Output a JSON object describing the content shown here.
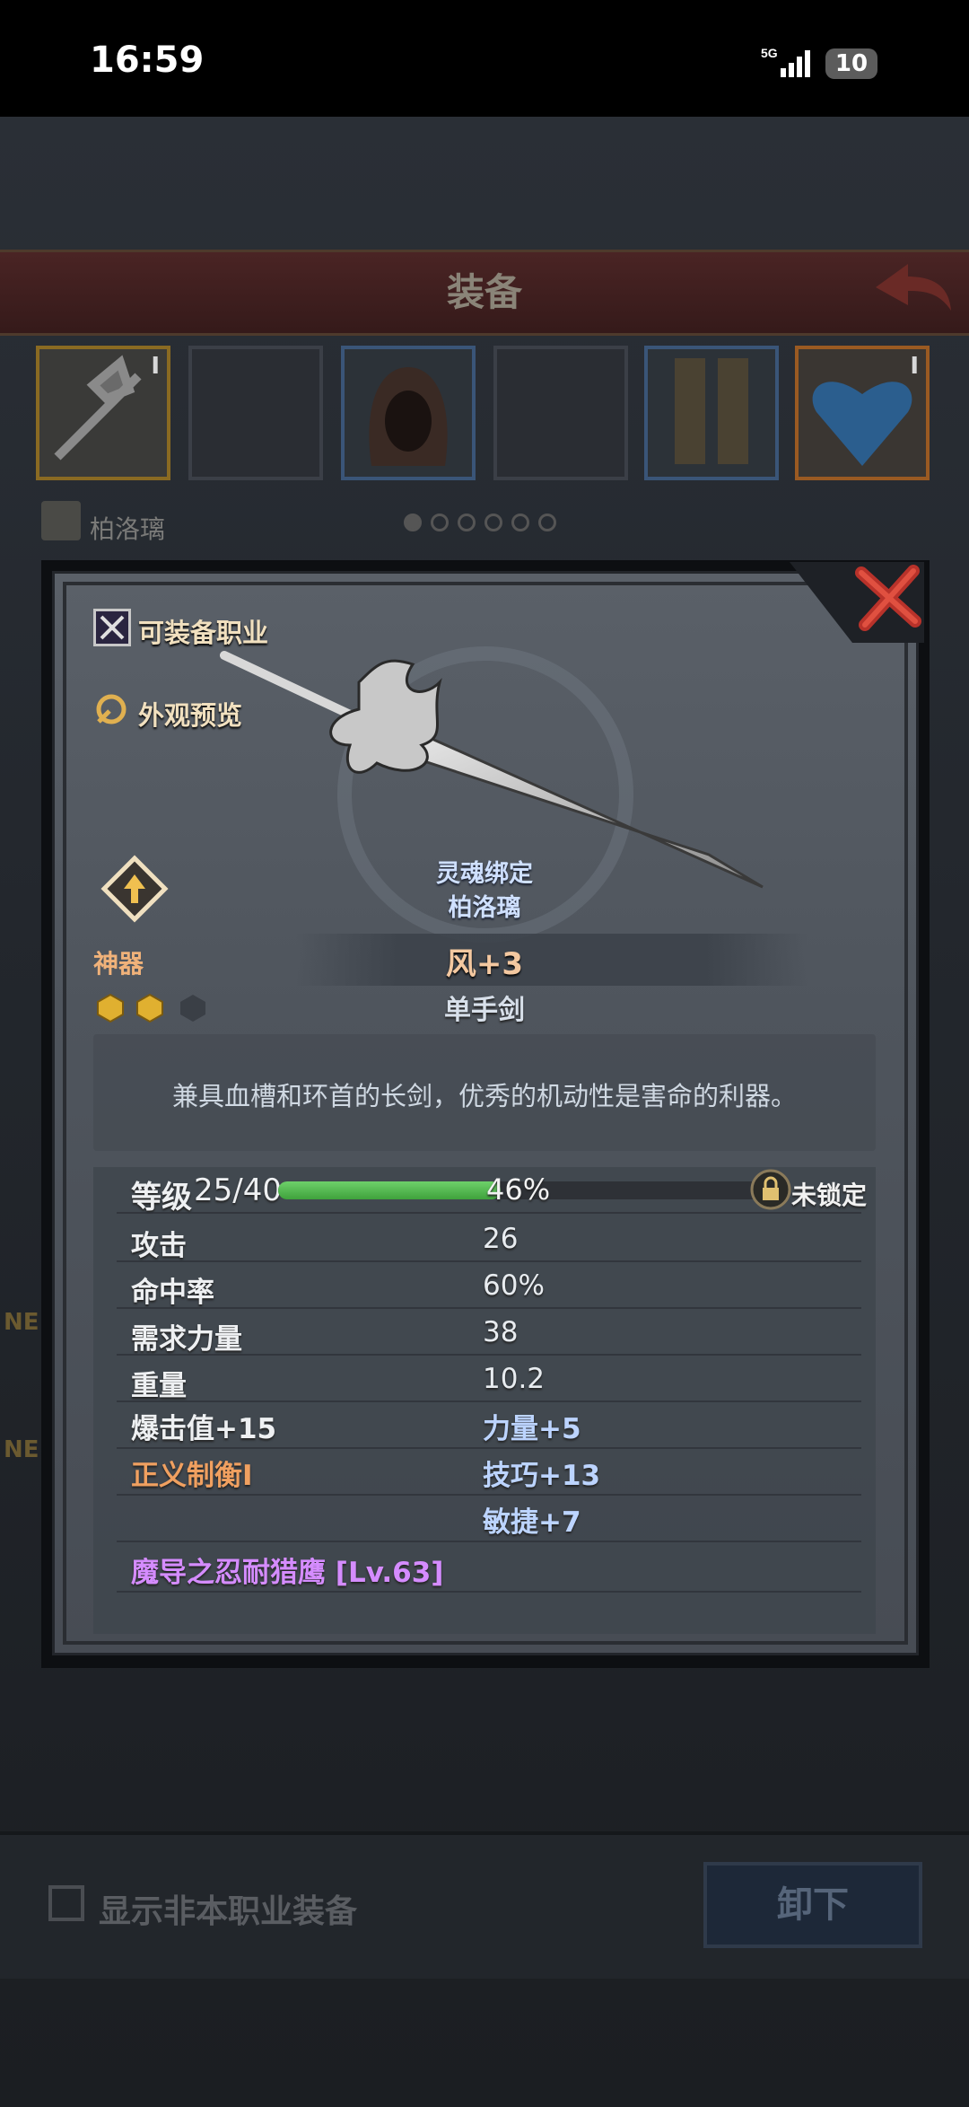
{
  "status_bar": {
    "time": "16:59",
    "network": "5G",
    "battery": "10"
  },
  "background": {
    "title": "装备",
    "owner": "柏洛璃",
    "show_other_class_label": "显示非本职业装备",
    "unequip_label": "卸下",
    "side_tag_1": "NE",
    "side_tag_2": "NE",
    "slot_badge_1": "I",
    "slot_badge_2": "I"
  },
  "dialog": {
    "equip_class_label": "可装备职业",
    "appearance_label": "外观预览",
    "soulbound_title": "灵魂绑定",
    "soulbound_owner": "柏洛璃",
    "rarity": "神器",
    "element": "风+3",
    "weapon_type": "单手剑",
    "gems": {
      "filled": 2,
      "total": 3
    },
    "description": "兼具血槽和环首的长剑，优秀的机动性是害命的利器。",
    "level": {
      "label": "等级",
      "value": "25/40",
      "percent_text": "46%",
      "progress": 0.46
    },
    "lock_status": "未锁定",
    "stats": [
      {
        "name": "攻击",
        "value": "26"
      },
      {
        "name": "命中率",
        "value": "60%"
      },
      {
        "name": "需求力量",
        "value": "38"
      },
      {
        "name": "重量",
        "value": "10.2"
      }
    ],
    "bonuses": {
      "crit": "爆击值+15",
      "str": "力量+5",
      "special": "正义制衡Ⅰ",
      "skill": "技巧+13",
      "agi": "敏捷+7"
    },
    "set_bonus": "魔导之忍耐猎鹰 [Lv.63]",
    "colors": {
      "rarity": "#f0b27a",
      "set": "#d58cff",
      "bonus": "#bcd4ff",
      "special": "#f0a060",
      "progress": "#4fb84a"
    }
  }
}
